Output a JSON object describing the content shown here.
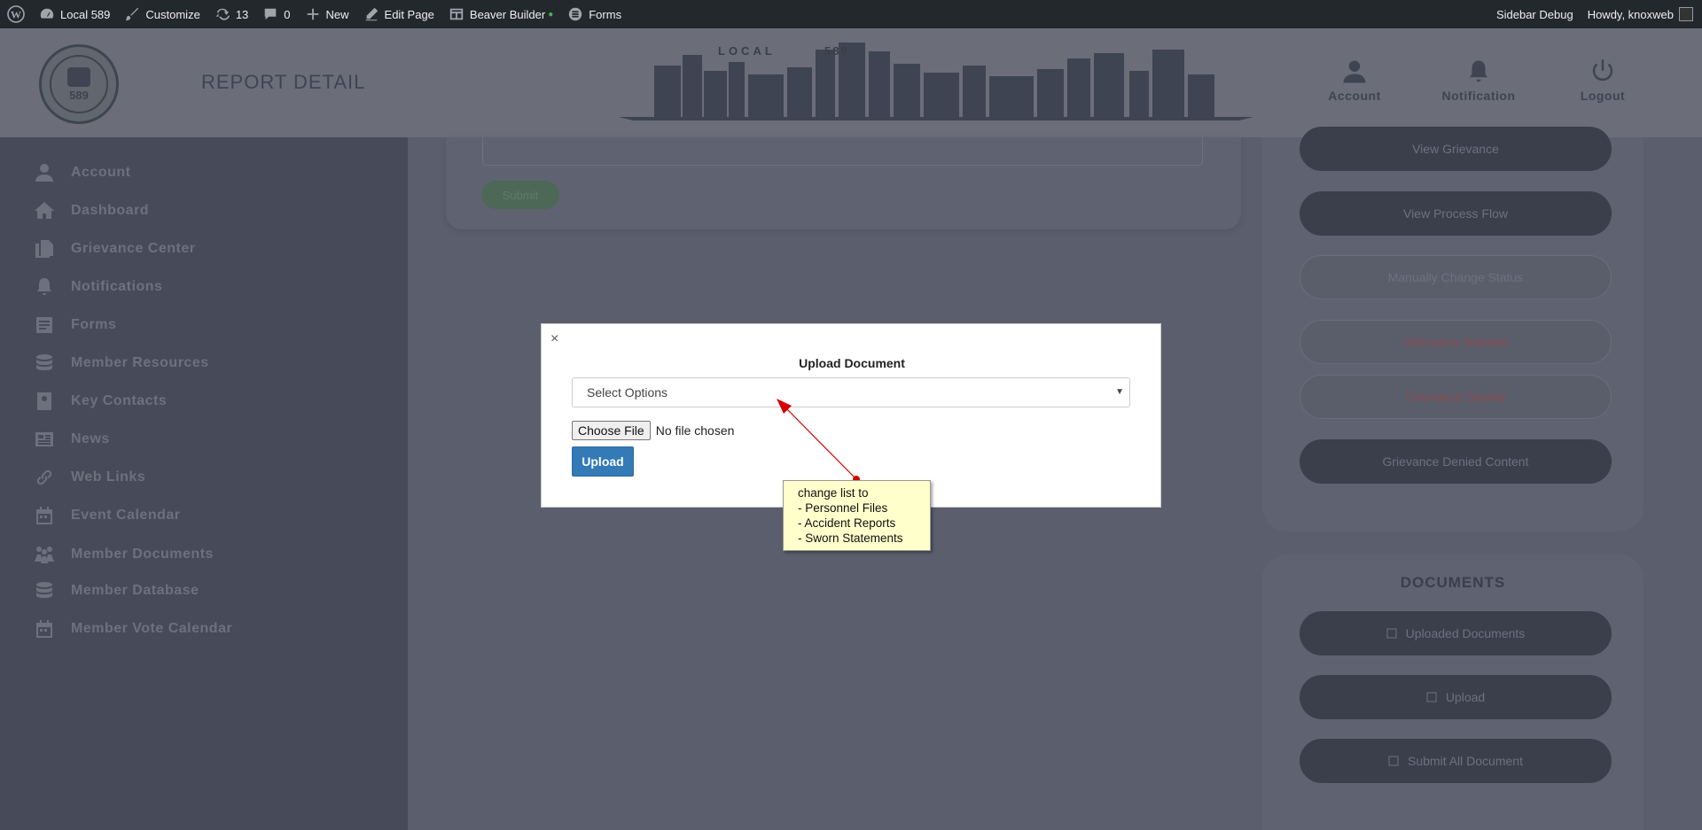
{
  "adminbar": {
    "site_name": "Local 589",
    "customize": "Customize",
    "updates_count": "13",
    "comments_count": "0",
    "new_label": "New",
    "edit_page": "Edit Page",
    "beaver_builder": "Beaver Builder",
    "forms": "Forms",
    "sidebar_debug": "Sidebar Debug",
    "howdy": "Howdy, knoxweb"
  },
  "header": {
    "page_title": "REPORT DETAIL",
    "logo_number": "589",
    "local_label": "LOCAL",
    "local_number": "589",
    "account": "Account",
    "notification": "Notification",
    "logout": "Logout"
  },
  "sidebar": {
    "items": [
      {
        "label": "Account",
        "icon": "user-icon"
      },
      {
        "label": "Dashboard",
        "icon": "home-icon"
      },
      {
        "label": "Grievance Center",
        "icon": "copy-icon"
      },
      {
        "label": "Notifications",
        "icon": "bell-icon"
      },
      {
        "label": "Forms",
        "icon": "form-icon"
      },
      {
        "label": "Member Resources",
        "icon": "database-icon"
      },
      {
        "label": "Key Contacts",
        "icon": "contact-icon"
      },
      {
        "label": "News",
        "icon": "newspaper-icon"
      },
      {
        "label": "Web Links",
        "icon": "link-icon"
      },
      {
        "label": "Event Calendar",
        "icon": "calendar-icon"
      },
      {
        "label": "Member Documents",
        "icon": "people-icon"
      },
      {
        "label": "Member Database",
        "icon": "database-icon"
      },
      {
        "label": "Member Vote Calendar",
        "icon": "calendar-icon"
      }
    ]
  },
  "main": {
    "submit_label": "Submit"
  },
  "right_panel": {
    "buttons": [
      "View Grievance",
      "View Process Flow",
      "Manually Change Status",
      "Grievance Granted",
      "Grievance Denied",
      "Grievance Denied Content"
    ],
    "documents_title": "DOCUMENTS",
    "doc_buttons": [
      "Uploaded Documents",
      "Upload",
      "Submit All Document"
    ]
  },
  "modal": {
    "close": "×",
    "title": "Upload Document",
    "select_value": "Select Options",
    "choose_file": "Choose File",
    "no_file": "No file chosen",
    "upload": "Upload"
  },
  "annotation": {
    "lines": [
      "change list to",
      "- Personnel Files",
      "- Accident Reports",
      "- Sworn Statements"
    ],
    "arrow_color": "#d40000"
  }
}
